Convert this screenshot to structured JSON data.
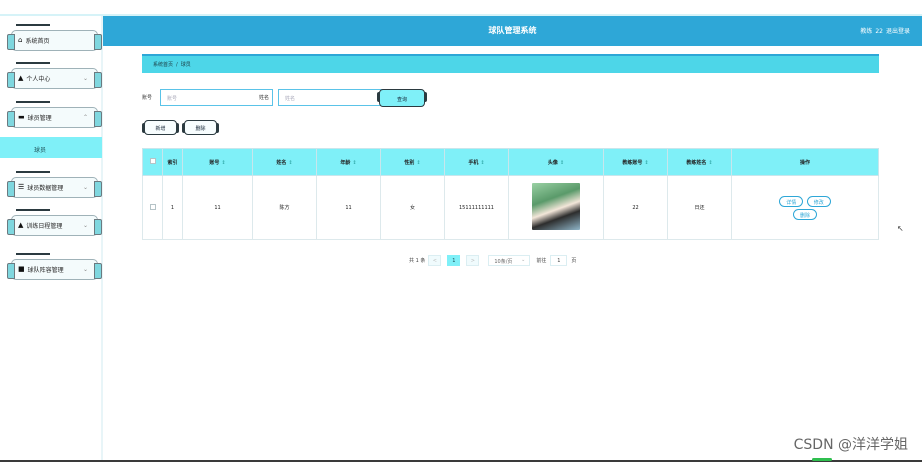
{
  "header": {
    "app_title": "球队管理系统",
    "user_label": "教练",
    "user_id": "22",
    "logout": "退出登录"
  },
  "sidebar": {
    "items": [
      {
        "icon": "⌂",
        "label": "系统首页",
        "chevron": ""
      },
      {
        "icon": "▲",
        "label": "个人中心",
        "chevron": "⌄"
      },
      {
        "icon": "▬",
        "label": "球员管理",
        "chevron": "⌃"
      },
      {
        "icon": "☰",
        "label": "球员数据管理",
        "chevron": "⌄"
      },
      {
        "icon": "▲",
        "label": "训练日程管理",
        "chevron": "⌄"
      },
      {
        "icon": "■",
        "label": "球队阵容管理",
        "chevron": "⌄"
      }
    ],
    "sub_item": "球员"
  },
  "breadcrumb": {
    "home": "系统首页",
    "separator": "/",
    "current": "球员"
  },
  "search": {
    "account_label": "账号",
    "account_placeholder": "账号",
    "name_label": "姓名",
    "name_placeholder": "姓名",
    "query_button": "查询"
  },
  "actions": {
    "add": "新增",
    "delete": "删除"
  },
  "table": {
    "headers": [
      "索引",
      "账号",
      "姓名",
      "年龄",
      "性别",
      "手机",
      "头像",
      "教练账号",
      "教练姓名",
      "操作"
    ],
    "rows": [
      {
        "index": "1",
        "account": "11",
        "name": "陈方",
        "age": "11",
        "gender": "女",
        "phone": "15111111111",
        "coach_account": "22",
        "coach_name": "日还",
        "ops": [
          "详情",
          "修改",
          "删除"
        ]
      }
    ]
  },
  "pagination": {
    "total": "共 1 条",
    "prev": "<",
    "page": "1",
    "next": ">",
    "page_size": "10条/页",
    "goto_label": "前往",
    "goto_value": "1",
    "goto_unit": "页"
  },
  "watermark": "CSDN @洋洋学姐",
  "colors": {
    "header": "#2ea7d7",
    "accent": "#7ff0f8",
    "breadcrumb": "#4dd6e8"
  }
}
